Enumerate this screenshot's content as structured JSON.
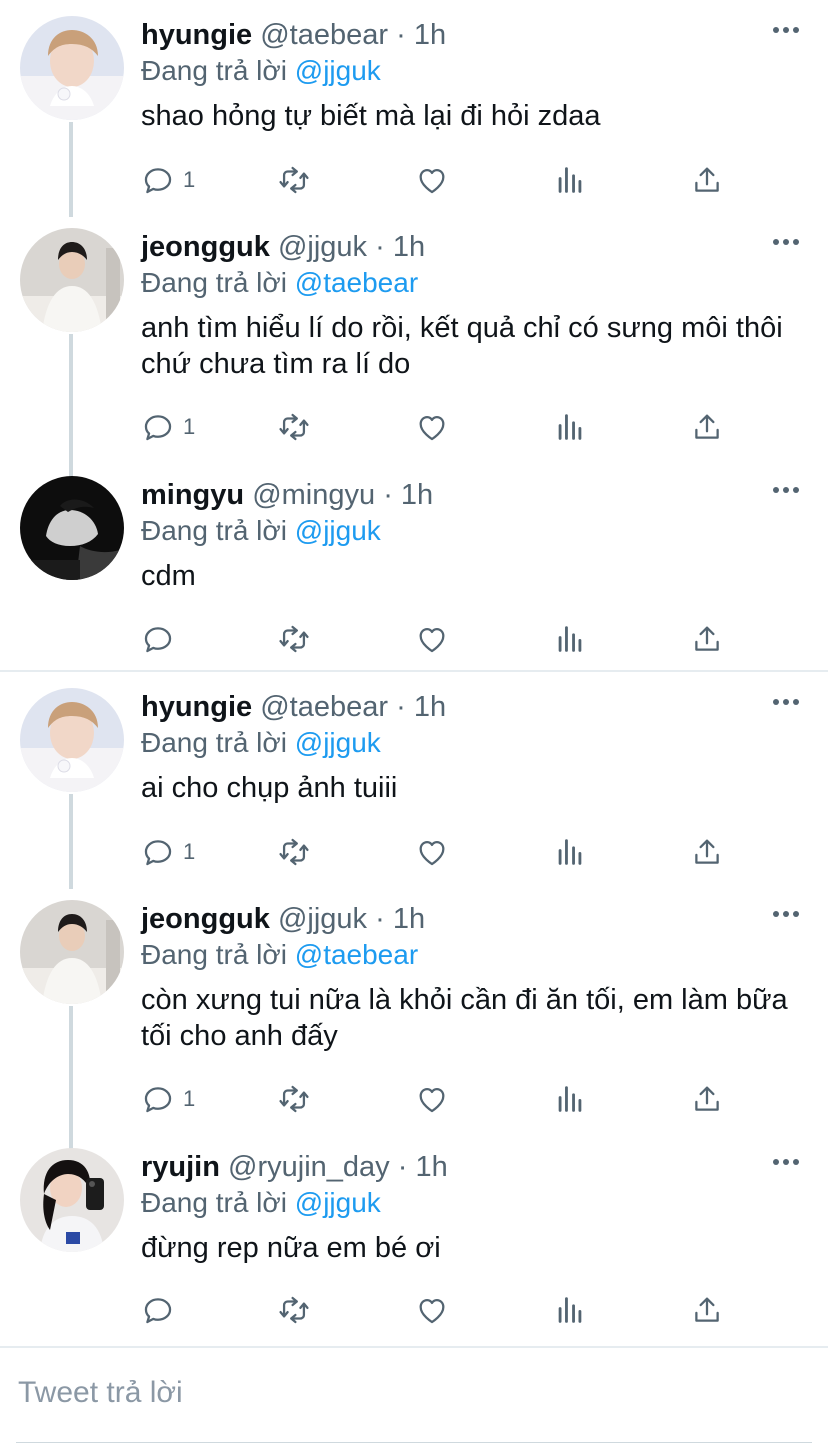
{
  "tweets": [
    {
      "name": "hyungie",
      "handle": "@taebear",
      "dot": "·",
      "time": "1h",
      "reply_prefix": "Đang trả lời",
      "reply_to": "@jjguk",
      "text": "shao hỏng tự biết mà lại đi hỏi zdaa",
      "reply_count": "1"
    },
    {
      "name": "jeongguk",
      "handle": "@jjguk",
      "dot": "·",
      "time": "1h",
      "reply_prefix": "Đang trả lời",
      "reply_to": "@taebear",
      "text": "anh tìm hiểu lí do rồi, kết quả chỉ có sưng môi thôi chứ chưa tìm ra lí do",
      "reply_count": "1"
    },
    {
      "name": "mingyu",
      "handle": "@mingyu",
      "dot": "·",
      "time": "1h",
      "reply_prefix": "Đang trả lời",
      "reply_to": "@jjguk",
      "text": "cdm",
      "reply_count": ""
    },
    {
      "name": "hyungie",
      "handle": "@taebear",
      "dot": "·",
      "time": "1h",
      "reply_prefix": "Đang trả lời",
      "reply_to": "@jjguk",
      "text": "ai cho chụp ảnh tuiii",
      "reply_count": "1"
    },
    {
      "name": "jeongguk",
      "handle": "@jjguk",
      "dot": "·",
      "time": "1h",
      "reply_prefix": "Đang trả lời",
      "reply_to": "@taebear",
      "text": "còn xưng tui nữa là khỏi cần đi ăn tối, em làm bữa tối cho anh đấy",
      "reply_count": "1"
    },
    {
      "name": "ryujin",
      "handle": "@ryujin_day",
      "dot": "·",
      "time": "1h",
      "reply_prefix": "Đang trả lời",
      "reply_to": "@jjguk",
      "text": "đừng rep nữa em bé ơi",
      "reply_count": ""
    }
  ],
  "composer": {
    "placeholder": "Tweet trả lời"
  },
  "icons": {
    "reply": "reply-icon",
    "retweet": "retweet-icon",
    "like": "heart-icon",
    "analytics": "analytics-icon",
    "share": "share-icon",
    "more": "more-icon"
  },
  "colors": {
    "mention": "#1d9bf0",
    "secondary_text": "#536471",
    "thread_line": "#cfd9de"
  }
}
